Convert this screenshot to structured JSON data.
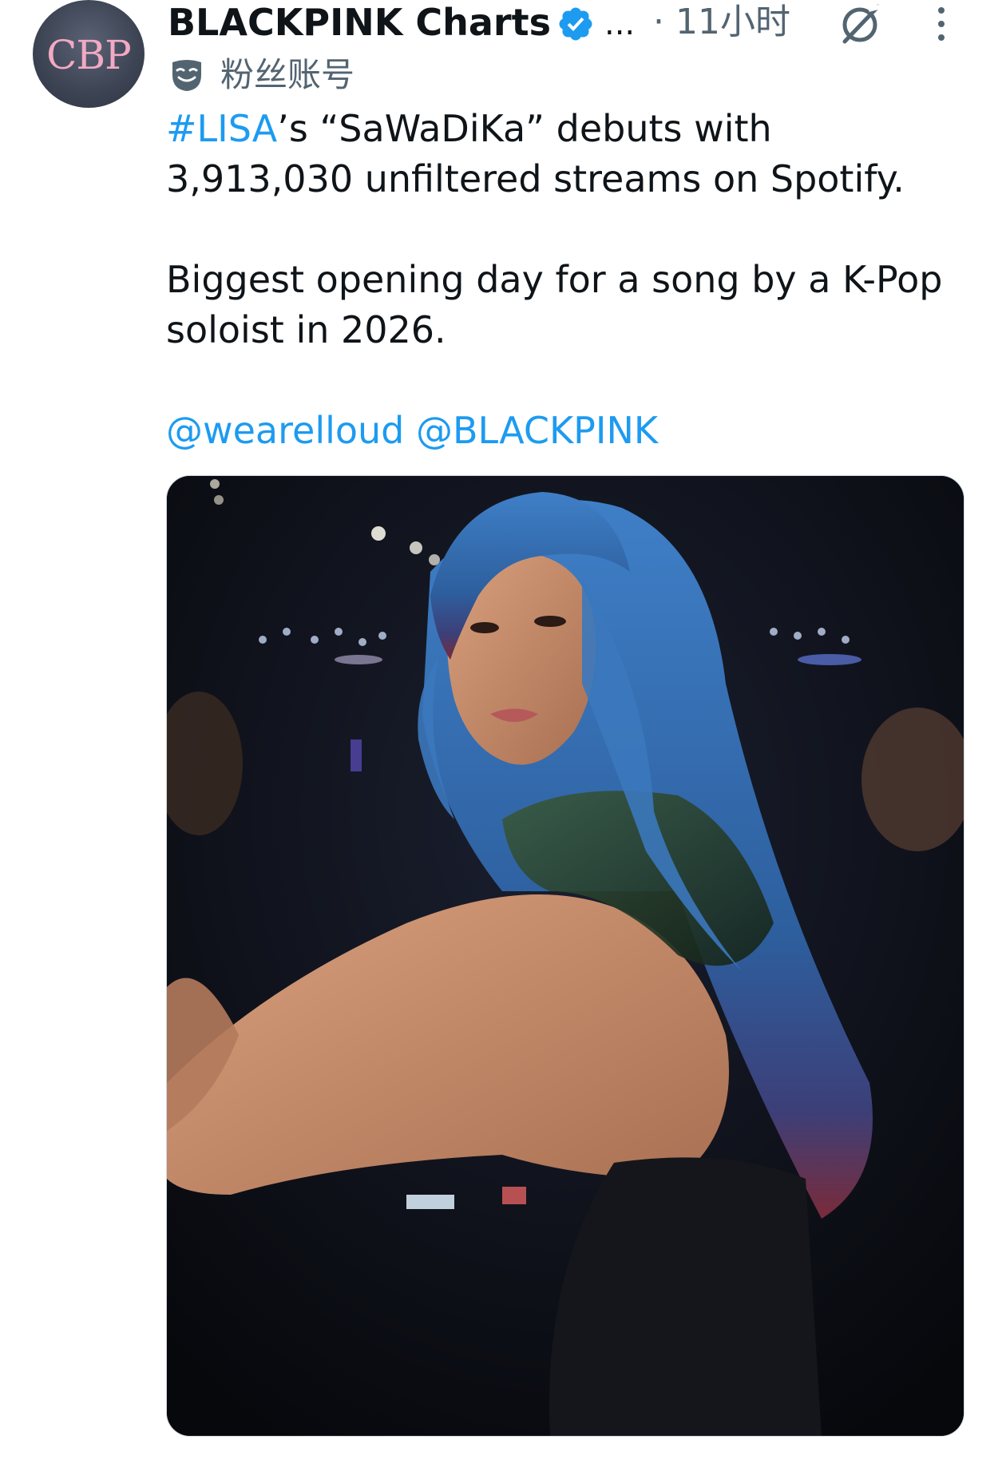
{
  "author": {
    "avatar_text": "CBP",
    "display_name": "BLACKPINK Charts",
    "more_glyph": "...",
    "timestamp": "· 11小时",
    "affiliation": "粉丝账号"
  },
  "tweet": {
    "hashtag": "#LISA",
    "line1_rest": "’s “SaWaDiKa” debuts with",
    "line2": "3,913,030 unfiltered streams on Spotify.",
    "para2": "Biggest opening day for a song by a K-Pop soloist in 2026.",
    "mention1": "@wearelloud",
    "mention2": "@BLACKPINK"
  },
  "colors": {
    "link": "#1d9bf0",
    "verified": "#1d9bf0",
    "secondary_text": "#536471",
    "avatar_text": "#f2a9c3"
  },
  "icons": [
    "verified-badge-icon",
    "grok-icon",
    "more-options-icon",
    "fan-account-mask-icon"
  ]
}
